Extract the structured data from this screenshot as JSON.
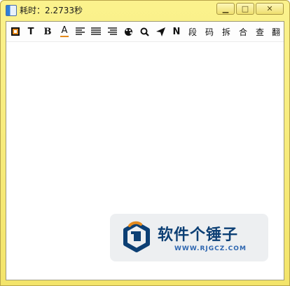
{
  "window": {
    "title": "耗时：2.2733秒",
    "controls": {
      "minimize": "▁",
      "maximize": "□",
      "close": "✕"
    }
  },
  "toolbar": {
    "items": [
      {
        "id": "border",
        "label": "",
        "icon": "square-frame-icon"
      },
      {
        "id": "text",
        "label": "T",
        "icon": "text-icon"
      },
      {
        "id": "bold",
        "label": "B",
        "icon": "bold-icon"
      },
      {
        "id": "color",
        "label": "A",
        "icon": "font-color-icon"
      },
      {
        "id": "align-left",
        "label": "",
        "icon": "align-left-icon"
      },
      {
        "id": "align-center",
        "label": "",
        "icon": "align-center-icon"
      },
      {
        "id": "align-right",
        "label": "",
        "icon": "align-right-icon"
      },
      {
        "id": "paint",
        "label": "",
        "icon": "palette-icon"
      },
      {
        "id": "search",
        "label": "",
        "icon": "search-icon"
      },
      {
        "id": "send",
        "label": "",
        "icon": "send-icon"
      },
      {
        "id": "new",
        "label": "N",
        "icon": "n-icon"
      },
      {
        "id": "segment",
        "label": "段"
      },
      {
        "id": "code",
        "label": "码"
      },
      {
        "id": "split",
        "label": "拆"
      },
      {
        "id": "merge",
        "label": "合"
      },
      {
        "id": "lookup",
        "label": "查"
      },
      {
        "id": "translate",
        "label": "翻"
      }
    ],
    "accent_color": "#e48a1e"
  },
  "watermark": {
    "title": "软件个锤子",
    "url": "WWW.RJGCZ.COM",
    "brand_color": "#0c3f74"
  }
}
